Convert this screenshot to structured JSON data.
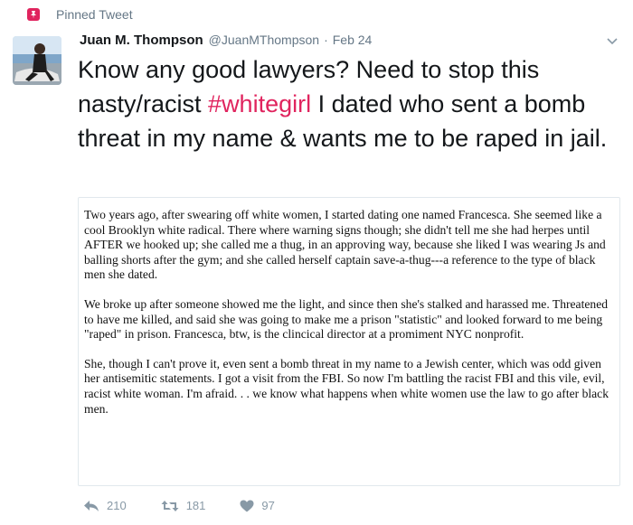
{
  "pinned": {
    "label": "Pinned Tweet"
  },
  "author": {
    "name": "Juan M. Thompson",
    "handle": "@JuanMThompson",
    "separator": "·",
    "date": "Feb 24"
  },
  "tweet": {
    "text_before": "Know any good lawyers? Need to stop this nasty/racist ",
    "hashtag": "#whitegirl",
    "text_after": " I dated who sent a bomb threat in my name & wants me to be raped in jail."
  },
  "attachment": {
    "paragraphs": [
      "Two years ago, after swearing off white women, I started dating one named Francesca. She seemed like a cool Brooklyn white radical. There where warning signs though; she didn't tell me she had herpes until AFTER we hooked up; she called me a thug, in an approving way, because she liked I was wearing Js and balling shorts after the gym; and she called herself captain save-a-thug---a reference to the type of black men she dated.",
      "We broke up after someone showed me the light, and since then she's stalked and harassed me. Threatened to have me killed, and said she was going to make me a prison \"statistic\" and looked forward to me being \"raped\" in prison. Francesca, btw, is the clincical director at a promiment NYC nonprofit.",
      "She, though I can't prove it, even sent a bomb threat in my name to a Jewish center, which was odd given her antisemitic statements. I got a visit from the FBI. So now I'm battling the racist FBI and this vile, evil, racist white woman. I'm afraid. . . we know what happens when white women use the law to go after black men."
    ]
  },
  "actions": {
    "reply_count": "210",
    "retweet_count": "181",
    "like_count": "97"
  },
  "colors": {
    "pin": "#e0245e",
    "hashtag": "#e0245e",
    "meta_gray": "#657786",
    "action_gray": "#8899a6"
  },
  "icons": {
    "pin": "pin-icon",
    "caret": "chevron-down-icon",
    "reply": "reply-icon",
    "retweet": "retweet-icon",
    "like": "heart-icon"
  }
}
